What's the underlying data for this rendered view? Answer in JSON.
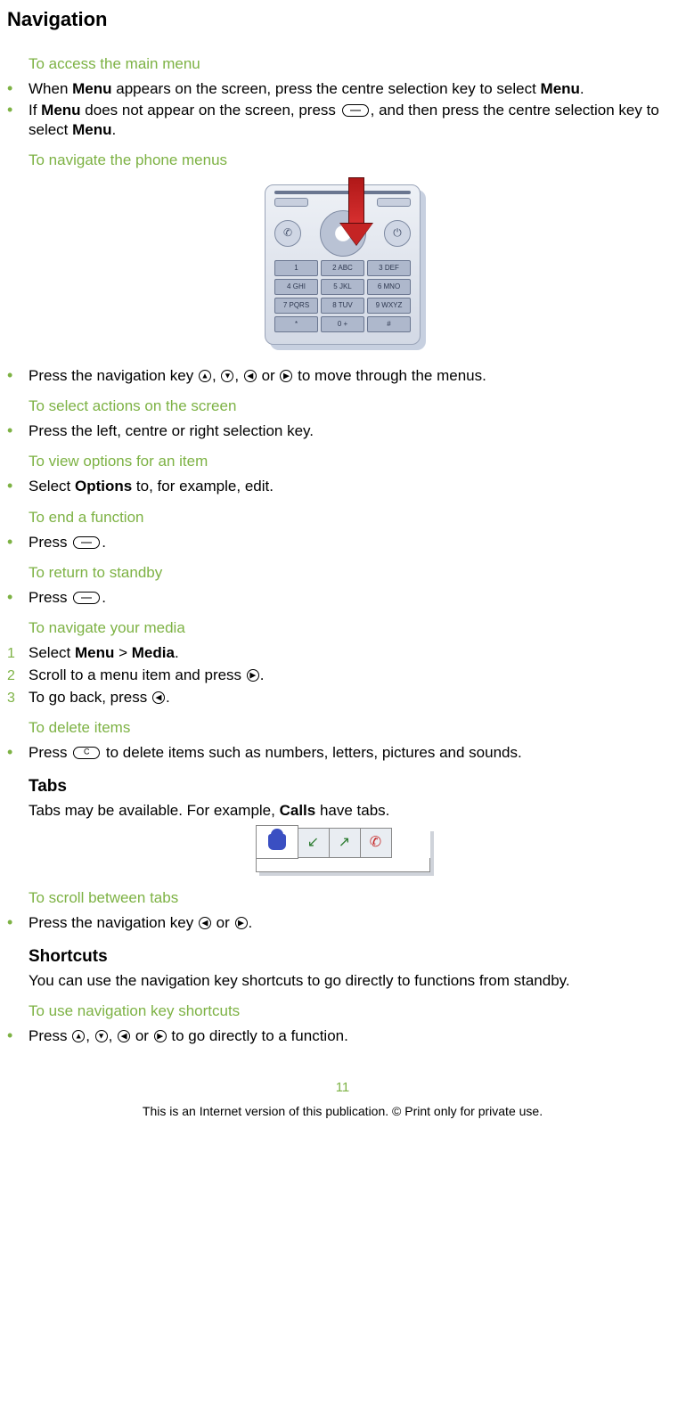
{
  "page_title": "Navigation",
  "page_number": "11",
  "footer": "This is an Internet version of this publication. © Print only for private use.",
  "sections": {
    "access_main_menu": {
      "heading": "To access the main menu",
      "b1_pre": "When ",
      "b1_bold1": "Menu",
      "b1_mid": " appears on the screen, press the centre selection key to select ",
      "b1_bold2": "Menu",
      "b1_post": ".",
      "b2_pre": "If ",
      "b2_bold1": "Menu",
      "b2_mid": " does not appear on the screen, press ",
      "b2_post1": ", and then press the centre selection key to select ",
      "b2_bold2": "Menu",
      "b2_post2": "."
    },
    "navigate_menus": {
      "heading": "To navigate the phone menus",
      "b1_pre": "Press the navigation key ",
      "b1_sep": ", ",
      "b1_or": " or ",
      "b1_post": " to move through the menus."
    },
    "select_actions": {
      "heading": "To select actions on the screen",
      "b1": "Press the left, centre or right selection key."
    },
    "view_options": {
      "heading": "To view options for an item",
      "b1_pre": "Select ",
      "b1_bold": "Options",
      "b1_post": " to, for example, edit."
    },
    "end_function": {
      "heading": "To end a function",
      "b1_pre": "Press ",
      "b1_post": "."
    },
    "return_standby": {
      "heading": "To return to standby",
      "b1_pre": "Press ",
      "b1_post": "."
    },
    "navigate_media": {
      "heading": "To navigate your media",
      "n1_pre": "Select ",
      "n1_bold1": "Menu",
      "n1_mid": " > ",
      "n1_bold2": "Media",
      "n1_post": ".",
      "n2_pre": "Scroll to a menu item and press ",
      "n2_post": ".",
      "n3_pre": "To go back, press ",
      "n3_post": "."
    },
    "delete_items": {
      "heading": "To delete items",
      "b1_pre": "Press ",
      "b1_post": " to delete items such as numbers, letters, pictures and sounds."
    },
    "tabs": {
      "heading": "Tabs",
      "para_pre": "Tabs may be available. For example, ",
      "para_bold": "Calls",
      "para_post": " have tabs."
    },
    "scroll_tabs": {
      "heading": "To scroll between tabs",
      "b1_pre": "Press the navigation key ",
      "b1_or": " or ",
      "b1_post": "."
    },
    "shortcuts": {
      "heading": "Shortcuts",
      "para": "You can use the navigation key shortcuts to go directly to functions from standby."
    },
    "use_shortcuts": {
      "heading": "To use navigation key shortcuts",
      "b1_pre": "Press ",
      "b1_sep": ", ",
      "b1_or": " or ",
      "b1_post": " to go directly to a function."
    }
  },
  "keypad": [
    "1",
    "2 ABC",
    "3 DEF",
    "4 GHI",
    "5 JKL",
    "6 MNO",
    "7 PQRS",
    "8 TUV",
    "9 WXYZ",
    "*",
    "0 +",
    "#"
  ]
}
